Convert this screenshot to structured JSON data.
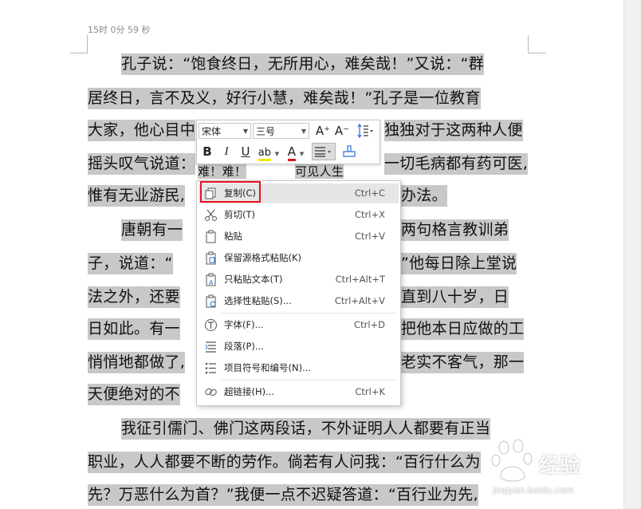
{
  "status": {
    "timer": "15时 0分 59 秒"
  },
  "document": {
    "lines": [
      "孔子说：“饱食终日，无所用心，难矣哉！”又说：“群",
      "居终日，言不及义，好行小慧，难矣哉！”孔子是一位教育",
      "大家，他心目中",
      "独独对于这两种人便",
      "摇头叹气说道：",
      "难！难！",
      "可见人生",
      "一切毛病都有药可医,",
      "惟有无业游民,",
      "办法。",
      "唐朝有一",
      "两句格言教训弟",
      "子，说道：“",
      "”他每日除上堂说",
      "法之外，还要",
      "直到八十岁，日",
      "日如此。有一",
      "把他本日应做的工",
      "悄悄地都做了,",
      "老实不客气，那一",
      "天便绝对的不",
      "我征引儒门、佛门这两段话，不外证明人人都要有正当",
      "职业，人人都要不断的劳作。倘若有人问我：“百行什么为",
      "先？万恶什么为首？”我便一点不迟疑答道：“百行业为先,"
    ]
  },
  "mini_toolbar": {
    "font_name": "宋体",
    "font_size": "三号",
    "grow_font": "A⁺",
    "shrink_font": "A⁻",
    "bold": "B",
    "italic": "I",
    "underline": "U",
    "highlight": "ab",
    "font_color": "A"
  },
  "context_menu": {
    "items": [
      {
        "label": "复制(C)",
        "shortcut": "Ctrl+C",
        "icon": "copy-icon"
      },
      {
        "label": "剪切(T)",
        "shortcut": "Ctrl+X",
        "icon": "scissors-icon"
      },
      {
        "label": "粘贴",
        "shortcut": "Ctrl+V",
        "icon": "paste-icon"
      },
      {
        "label": "保留源格式粘贴(K)",
        "shortcut": "",
        "icon": "paste-keep-format-icon"
      },
      {
        "label": "只粘贴文本(T)",
        "shortcut": "Ctrl+Alt+T",
        "icon": "paste-text-icon"
      },
      {
        "label": "选择性粘贴(S)...",
        "shortcut": "Ctrl+Alt+V",
        "icon": "paste-special-icon"
      },
      {
        "label": "字体(F)...",
        "shortcut": "Ctrl+D",
        "icon": "font-icon"
      },
      {
        "label": "段落(P)...",
        "shortcut": "",
        "icon": "paragraph-icon"
      },
      {
        "label": "项目符号和编号(N)...",
        "shortcut": "",
        "icon": "bullets-icon"
      },
      {
        "label": "超链接(H)...",
        "shortcut": "Ctrl+K",
        "icon": "link-icon"
      }
    ]
  },
  "watermark": {
    "title": "经验",
    "url": "jingyan.baidu.com"
  },
  "colors": {
    "selection": "#c8c8c8",
    "highlight_border": "#e3151d",
    "menu_hover": "#e6e6e6"
  }
}
